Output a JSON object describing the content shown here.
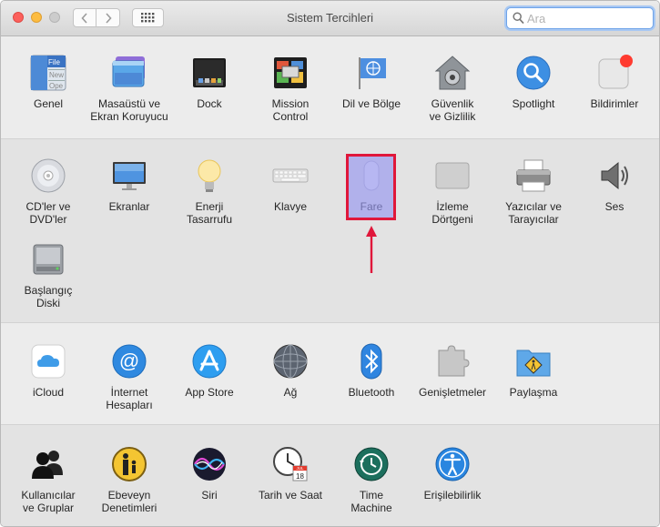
{
  "window": {
    "title": "Sistem Tercihleri"
  },
  "search": {
    "placeholder": "Ara",
    "value": ""
  },
  "sections": [
    {
      "panes": [
        {
          "label": "Genel",
          "icon": "general-icon"
        },
        {
          "label": "Masaüstü ve\nEkran Koruyucu",
          "icon": "desktop-screensaver-icon"
        },
        {
          "label": "Dock",
          "icon": "dock-icon"
        },
        {
          "label": "Mission\nControl",
          "icon": "mission-control-icon"
        },
        {
          "label": "Dil ve Bölge",
          "icon": "language-region-icon"
        },
        {
          "label": "Güvenlik\nve Gizlilik",
          "icon": "security-privacy-icon"
        },
        {
          "label": "Spotlight",
          "icon": "spotlight-icon"
        },
        {
          "label": "Bildirimler",
          "icon": "notifications-icon"
        }
      ]
    },
    {
      "panes": [
        {
          "label": "CD'ler ve\nDVD'ler",
          "icon": "cd-dvd-icon"
        },
        {
          "label": "Ekranlar",
          "icon": "displays-icon"
        },
        {
          "label": "Enerji\nTasarrufu",
          "icon": "energy-saver-icon"
        },
        {
          "label": "Klavye",
          "icon": "keyboard-icon"
        },
        {
          "label": "Fare",
          "icon": "mouse-icon"
        },
        {
          "label": "İzleme\nDörtgeni",
          "icon": "trackpad-icon"
        },
        {
          "label": "Yazıcılar ve\nTarayıcılar",
          "icon": "printer-scanner-icon"
        },
        {
          "label": "Ses",
          "icon": "sound-icon"
        },
        {
          "label": "Başlangıç\nDiski",
          "icon": "startup-disk-icon"
        }
      ]
    },
    {
      "panes": [
        {
          "label": "iCloud",
          "icon": "icloud-icon"
        },
        {
          "label": "İnternet\nHesapları",
          "icon": "internet-accounts-icon"
        },
        {
          "label": "App Store",
          "icon": "app-store-icon"
        },
        {
          "label": "Ağ",
          "icon": "network-icon"
        },
        {
          "label": "Bluetooth",
          "icon": "bluetooth-icon"
        },
        {
          "label": "Genişletmeler",
          "icon": "extensions-icon"
        },
        {
          "label": "Paylaşma",
          "icon": "sharing-icon"
        }
      ]
    },
    {
      "panes": [
        {
          "label": "Kullanıcılar\nve Gruplar",
          "icon": "users-groups-icon"
        },
        {
          "label": "Ebeveyn\nDenetimleri",
          "icon": "parental-controls-icon"
        },
        {
          "label": "Siri",
          "icon": "siri-icon"
        },
        {
          "label": "Tarih ve Saat",
          "icon": "date-time-icon"
        },
        {
          "label": "Time\nMachine",
          "icon": "time-machine-icon"
        },
        {
          "label": "Erişilebilirlik",
          "icon": "accessibility-icon"
        }
      ]
    }
  ],
  "icon_text": {
    "general": "File\nNew\nOpe",
    "date_month": "JUL",
    "date_day": "18"
  },
  "annotation": {
    "highlighted_pane": "Fare",
    "color": "#e0173b"
  }
}
